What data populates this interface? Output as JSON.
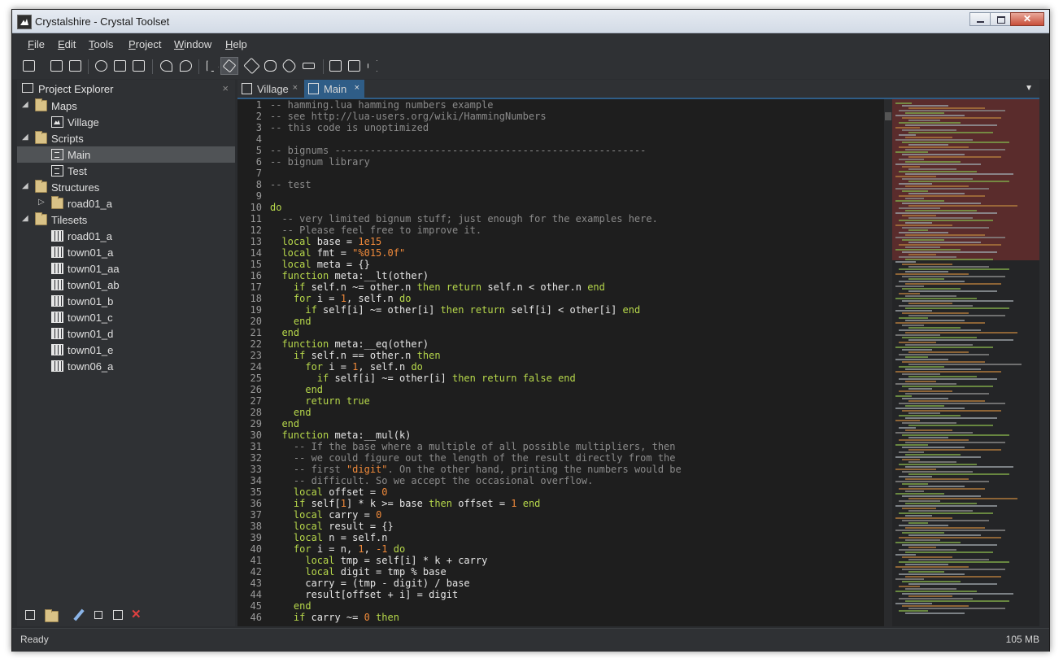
{
  "window": {
    "title": "Crystalshire - Crystal Toolset"
  },
  "menu": [
    "File",
    "Edit",
    "Tools",
    "Project",
    "Window",
    "Help"
  ],
  "toolbar": {
    "icons": [
      "new-dropdown-icon",
      "save-icon",
      "save-all-icon",
      "cut-icon",
      "copy-icon",
      "paste-icon",
      "undo-icon",
      "redo-icon",
      "select-pointer-icon",
      "brush-icon",
      "eraser-icon",
      "hand-icon",
      "eyedropper-icon",
      "rectangle-icon",
      "layer-icon",
      "image-icon",
      "sound-icon"
    ]
  },
  "explorer": {
    "title": "Project Explorer",
    "close": "×",
    "tree": [
      {
        "label": "Maps",
        "type": "folder",
        "depth": 0,
        "expanded": true
      },
      {
        "label": "Village",
        "type": "map",
        "depth": 1
      },
      {
        "label": "Scripts",
        "type": "folder",
        "depth": 0,
        "expanded": true
      },
      {
        "label": "Main",
        "type": "script",
        "depth": 1,
        "selected": true
      },
      {
        "label": "Test",
        "type": "script",
        "depth": 1
      },
      {
        "label": "Structures",
        "type": "folder",
        "depth": 0,
        "expanded": true
      },
      {
        "label": "road01_a",
        "type": "folder",
        "depth": 1,
        "expanded": false
      },
      {
        "label": "Tilesets",
        "type": "folder",
        "depth": 0,
        "expanded": true
      },
      {
        "label": "road01_a",
        "type": "tileset",
        "depth": 1
      },
      {
        "label": "town01_a",
        "type": "tileset",
        "depth": 1
      },
      {
        "label": "town01_aa",
        "type": "tileset",
        "depth": 1
      },
      {
        "label": "town01_ab",
        "type": "tileset",
        "depth": 1
      },
      {
        "label": "town01_b",
        "type": "tileset",
        "depth": 1
      },
      {
        "label": "town01_c",
        "type": "tileset",
        "depth": 1
      },
      {
        "label": "town01_d",
        "type": "tileset",
        "depth": 1
      },
      {
        "label": "town01_e",
        "type": "tileset",
        "depth": 1
      },
      {
        "label": "town06_a",
        "type": "tileset",
        "depth": 1
      }
    ],
    "footer_icons": [
      "add-dropdown-icon",
      "add-folder-icon",
      "edit-pencil-icon",
      "rename-icon",
      "duplicate-icon",
      "delete-icon"
    ]
  },
  "tabs": [
    {
      "label": "Village",
      "close": "×",
      "active": false
    },
    {
      "label": "Main",
      "close": "×",
      "active": true
    }
  ],
  "editor": {
    "lines": [
      [
        [
          "c",
          "-- hamming.lua hamming numbers example"
        ]
      ],
      [
        [
          "c",
          "-- see http://lua-users.org/wiki/HammingNumbers"
        ]
      ],
      [
        [
          "c",
          "-- this code is unoptimized"
        ]
      ],
      [],
      [
        [
          "c",
          "-- bignums -----------------------------------------------------"
        ]
      ],
      [
        [
          "c",
          "-- bignum library"
        ]
      ],
      [],
      [
        [
          "c",
          "-- test"
        ]
      ],
      [],
      [
        [
          "k",
          "do"
        ]
      ],
      [
        [
          "t",
          "  "
        ],
        [
          "c",
          "-- very limited bignum stuff; just enough for the examples here."
        ]
      ],
      [
        [
          "t",
          "  "
        ],
        [
          "c",
          "-- Please feel free to improve it."
        ]
      ],
      [
        [
          "t",
          "  "
        ],
        [
          "k",
          "local"
        ],
        [
          "t",
          " base = "
        ],
        [
          "n",
          "1e15"
        ]
      ],
      [
        [
          "t",
          "  "
        ],
        [
          "k",
          "local"
        ],
        [
          "t",
          " fmt = "
        ],
        [
          "s",
          "\"%015.0f\""
        ]
      ],
      [
        [
          "t",
          "  "
        ],
        [
          "k",
          "local"
        ],
        [
          "t",
          " meta = {}"
        ]
      ],
      [
        [
          "t",
          "  "
        ],
        [
          "k",
          "function"
        ],
        [
          "t",
          " meta:__lt(other)"
        ]
      ],
      [
        [
          "t",
          "    "
        ],
        [
          "k",
          "if"
        ],
        [
          "t",
          " self.n ~= other.n "
        ],
        [
          "k",
          "then"
        ],
        [
          "t",
          " "
        ],
        [
          "k",
          "return"
        ],
        [
          "t",
          " self.n < other.n "
        ],
        [
          "k",
          "end"
        ]
      ],
      [
        [
          "t",
          "    "
        ],
        [
          "k",
          "for"
        ],
        [
          "t",
          " i = "
        ],
        [
          "n",
          "1"
        ],
        [
          "t",
          ", self.n "
        ],
        [
          "k",
          "do"
        ]
      ],
      [
        [
          "t",
          "      "
        ],
        [
          "k",
          "if"
        ],
        [
          "t",
          " self[i] ~= other[i] "
        ],
        [
          "k",
          "then"
        ],
        [
          "t",
          " "
        ],
        [
          "k",
          "return"
        ],
        [
          "t",
          " self[i] < other[i] "
        ],
        [
          "k",
          "end"
        ]
      ],
      [
        [
          "t",
          "    "
        ],
        [
          "k",
          "end"
        ]
      ],
      [
        [
          "t",
          "  "
        ],
        [
          "k",
          "end"
        ]
      ],
      [
        [
          "t",
          "  "
        ],
        [
          "k",
          "function"
        ],
        [
          "t",
          " meta:__eq(other)"
        ]
      ],
      [
        [
          "t",
          "    "
        ],
        [
          "k",
          "if"
        ],
        [
          "t",
          " self.n == other.n "
        ],
        [
          "k",
          "then"
        ]
      ],
      [
        [
          "t",
          "      "
        ],
        [
          "k",
          "for"
        ],
        [
          "t",
          " i = "
        ],
        [
          "n",
          "1"
        ],
        [
          "t",
          ", self.n "
        ],
        [
          "k",
          "do"
        ]
      ],
      [
        [
          "t",
          "        "
        ],
        [
          "k",
          "if"
        ],
        [
          "t",
          " self[i] ~= other[i] "
        ],
        [
          "k",
          "then"
        ],
        [
          "t",
          " "
        ],
        [
          "k",
          "return"
        ],
        [
          "t",
          " "
        ],
        [
          "k",
          "false"
        ],
        [
          "t",
          " "
        ],
        [
          "k",
          "end"
        ]
      ],
      [
        [
          "t",
          "      "
        ],
        [
          "k",
          "end"
        ]
      ],
      [
        [
          "t",
          "      "
        ],
        [
          "k",
          "return"
        ],
        [
          "t",
          " "
        ],
        [
          "k",
          "true"
        ]
      ],
      [
        [
          "t",
          "    "
        ],
        [
          "k",
          "end"
        ]
      ],
      [
        [
          "t",
          "  "
        ],
        [
          "k",
          "end"
        ]
      ],
      [
        [
          "t",
          "  "
        ],
        [
          "k",
          "function"
        ],
        [
          "t",
          " meta:__mul(k)"
        ]
      ],
      [
        [
          "t",
          "    "
        ],
        [
          "c",
          "-- If the base where a multiple of all possible multipliers, then"
        ]
      ],
      [
        [
          "t",
          "    "
        ],
        [
          "c",
          "-- we could figure out the length of the result directly from the"
        ]
      ],
      [
        [
          "t",
          "    "
        ],
        [
          "c",
          "-- first "
        ],
        [
          "s",
          "\"digit\""
        ],
        [
          "c",
          ". On the other hand, printing the numbers would be"
        ]
      ],
      [
        [
          "t",
          "    "
        ],
        [
          "c",
          "-- difficult. So we accept the occasional overflow."
        ]
      ],
      [
        [
          "t",
          "    "
        ],
        [
          "k",
          "local"
        ],
        [
          "t",
          " offset = "
        ],
        [
          "n",
          "0"
        ]
      ],
      [
        [
          "t",
          "    "
        ],
        [
          "k",
          "if"
        ],
        [
          "t",
          " self["
        ],
        [
          "n",
          "1"
        ],
        [
          "t",
          "] * k >= base "
        ],
        [
          "k",
          "then"
        ],
        [
          "t",
          " offset = "
        ],
        [
          "n",
          "1"
        ],
        [
          "t",
          " "
        ],
        [
          "k",
          "end"
        ]
      ],
      [
        [
          "t",
          "    "
        ],
        [
          "k",
          "local"
        ],
        [
          "t",
          " carry = "
        ],
        [
          "n",
          "0"
        ]
      ],
      [
        [
          "t",
          "    "
        ],
        [
          "k",
          "local"
        ],
        [
          "t",
          " result = {}"
        ]
      ],
      [
        [
          "t",
          "    "
        ],
        [
          "k",
          "local"
        ],
        [
          "t",
          " n = self.n"
        ]
      ],
      [
        [
          "t",
          "    "
        ],
        [
          "k",
          "for"
        ],
        [
          "t",
          " i = n, "
        ],
        [
          "n",
          "1"
        ],
        [
          "t",
          ", "
        ],
        [
          "n",
          "-1"
        ],
        [
          "t",
          " "
        ],
        [
          "k",
          "do"
        ]
      ],
      [
        [
          "t",
          "      "
        ],
        [
          "k",
          "local"
        ],
        [
          "t",
          " tmp = self[i] * k + carry"
        ]
      ],
      [
        [
          "t",
          "      "
        ],
        [
          "k",
          "local"
        ],
        [
          "t",
          " digit = tmp % base"
        ]
      ],
      [
        [
          "t",
          "      carry = (tmp - digit) / base"
        ]
      ],
      [
        [
          "t",
          "      result[offset + i] = digit"
        ]
      ],
      [
        [
          "t",
          "    "
        ],
        [
          "k",
          "end"
        ]
      ],
      [
        [
          "t",
          "    "
        ],
        [
          "k",
          "if"
        ],
        [
          "t",
          " carry ~= "
        ],
        [
          "n",
          "0"
        ],
        [
          "t",
          " "
        ],
        [
          "k",
          "then"
        ]
      ]
    ]
  },
  "status": {
    "text": "Ready",
    "memory": "105 MB"
  }
}
